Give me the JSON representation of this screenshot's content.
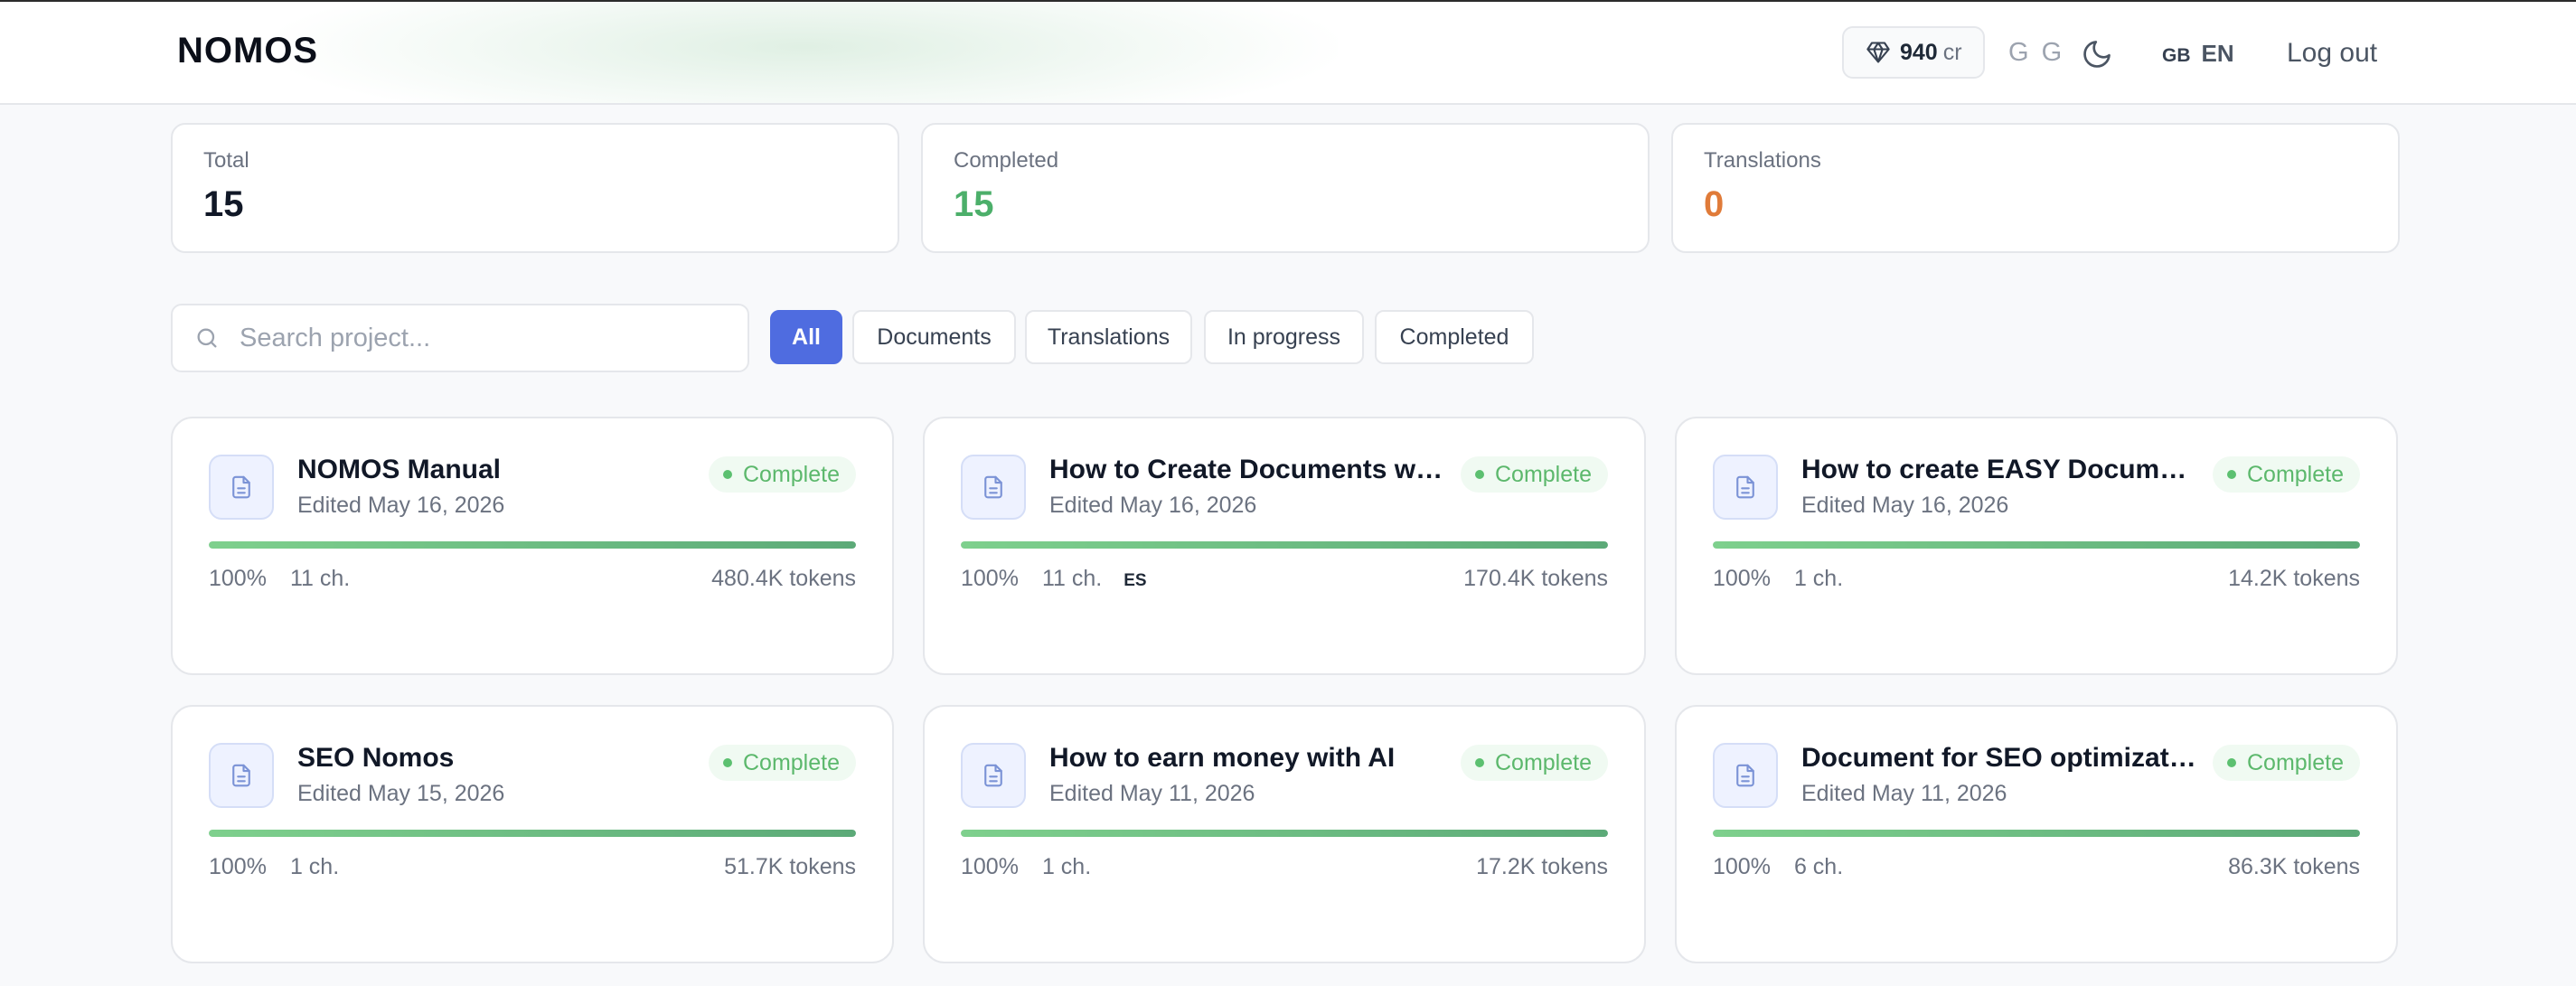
{
  "header": {
    "logo": "NOMOS",
    "credits_value": "940",
    "credits_unit": "cr",
    "user_initials": "G G",
    "lang_flag": "GB",
    "lang_code": "EN",
    "logout": "Log out"
  },
  "stats": [
    {
      "label": "Total",
      "value": "15",
      "color": "#111827"
    },
    {
      "label": "Completed",
      "value": "15",
      "color": "#4caf6a"
    },
    {
      "label": "Translations",
      "value": "0",
      "color": "#e07b39"
    }
  ],
  "search": {
    "placeholder": "Search project...",
    "value": ""
  },
  "filters": [
    {
      "label": "All",
      "active": true
    },
    {
      "label": "Documents",
      "active": false
    },
    {
      "label": "Translations",
      "active": false
    },
    {
      "label": "In progress",
      "active": false
    },
    {
      "label": "Completed",
      "active": false
    }
  ],
  "projects": [
    {
      "title": "NOMOS Manual",
      "edited": "Edited May 16, 2026",
      "status": "Complete",
      "progress": 100,
      "percent": "100%",
      "chapters": "11 ch.",
      "tag": "",
      "tokens": "480.4K tokens"
    },
    {
      "title": "How to Create Documents with...",
      "edited": "Edited May 16, 2026",
      "status": "Complete",
      "progress": 100,
      "percent": "100%",
      "chapters": "11 ch.",
      "tag": "ES",
      "tokens": "170.4K tokens"
    },
    {
      "title": "How to create EASY Document...",
      "edited": "Edited May 16, 2026",
      "status": "Complete",
      "progress": 100,
      "percent": "100%",
      "chapters": "1 ch.",
      "tag": "",
      "tokens": "14.2K tokens"
    },
    {
      "title": "SEO Nomos",
      "edited": "Edited May 15, 2026",
      "status": "Complete",
      "progress": 100,
      "percent": "100%",
      "chapters": "1 ch.",
      "tag": "",
      "tokens": "51.7K tokens"
    },
    {
      "title": "How to earn money with AI",
      "edited": "Edited May 11, 2026",
      "status": "Complete",
      "progress": 100,
      "percent": "100%",
      "chapters": "1 ch.",
      "tag": "",
      "tokens": "17.2K tokens"
    },
    {
      "title": "Document for SEO optimization",
      "edited": "Edited May 11, 2026",
      "status": "Complete",
      "progress": 100,
      "percent": "100%",
      "chapters": "6 ch.",
      "tag": "",
      "tokens": "86.3K tokens"
    }
  ],
  "icons": {
    "credits": "diamond-icon",
    "theme": "moon-icon",
    "search": "search-icon",
    "project": "document-icon"
  }
}
